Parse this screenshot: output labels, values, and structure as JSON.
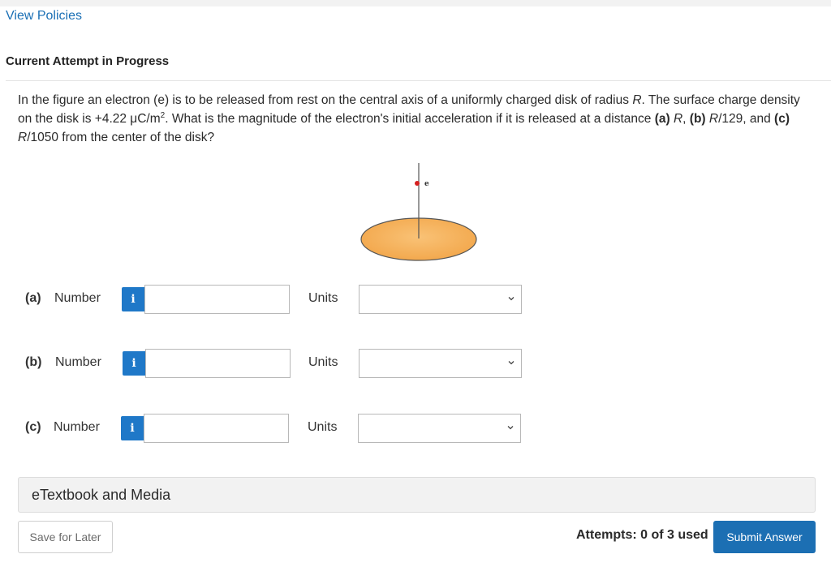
{
  "header": {
    "view_policies": "View Policies",
    "attempt_status": "Current Attempt in Progress"
  },
  "question": {
    "s1": "In the figure an electron (e) is to be released from rest on the central axis of a uniformly charged disk of radius ",
    "var_R1": "R",
    "s2": ". The surface charge density on the disk is +4.22 μC/m",
    "exp2": "2",
    "s3": ". What is the magnitude of the electron's initial acceleration if it is released at a distance ",
    "a_label": "(a)",
    "var_R2": "R",
    "comma": ",",
    "b_label": "(b)",
    "var_R3": "R",
    "s4": "/129, and ",
    "c_label": "(c)",
    "var_R4": "R",
    "s5": "/1050 from the center of the disk?"
  },
  "figure": {
    "electron_label": "e",
    "disk_color": "#f2a64a",
    "electron_color": "#d62020"
  },
  "parts": [
    {
      "letter": "(a)",
      "number_label": "Number",
      "info": "i",
      "value": "",
      "units_label": "Units",
      "units_selected": ""
    },
    {
      "letter": "(b)",
      "number_label": "Number",
      "info": "i",
      "value": "",
      "units_label": "Units",
      "units_selected": ""
    },
    {
      "letter": "(c)",
      "number_label": "Number",
      "info": "i",
      "value": "",
      "units_label": "Units",
      "units_selected": ""
    }
  ],
  "etextbook": {
    "label": "eTextbook and Media"
  },
  "footer": {
    "save_label": "Save for Later",
    "attempts_text": "Attempts: 0 of 3 used",
    "submit_label": "Submit Answer"
  },
  "colors": {
    "link": "#1a6fb5",
    "info_button": "#1f78c8",
    "submit_button": "#1c6fb3"
  }
}
